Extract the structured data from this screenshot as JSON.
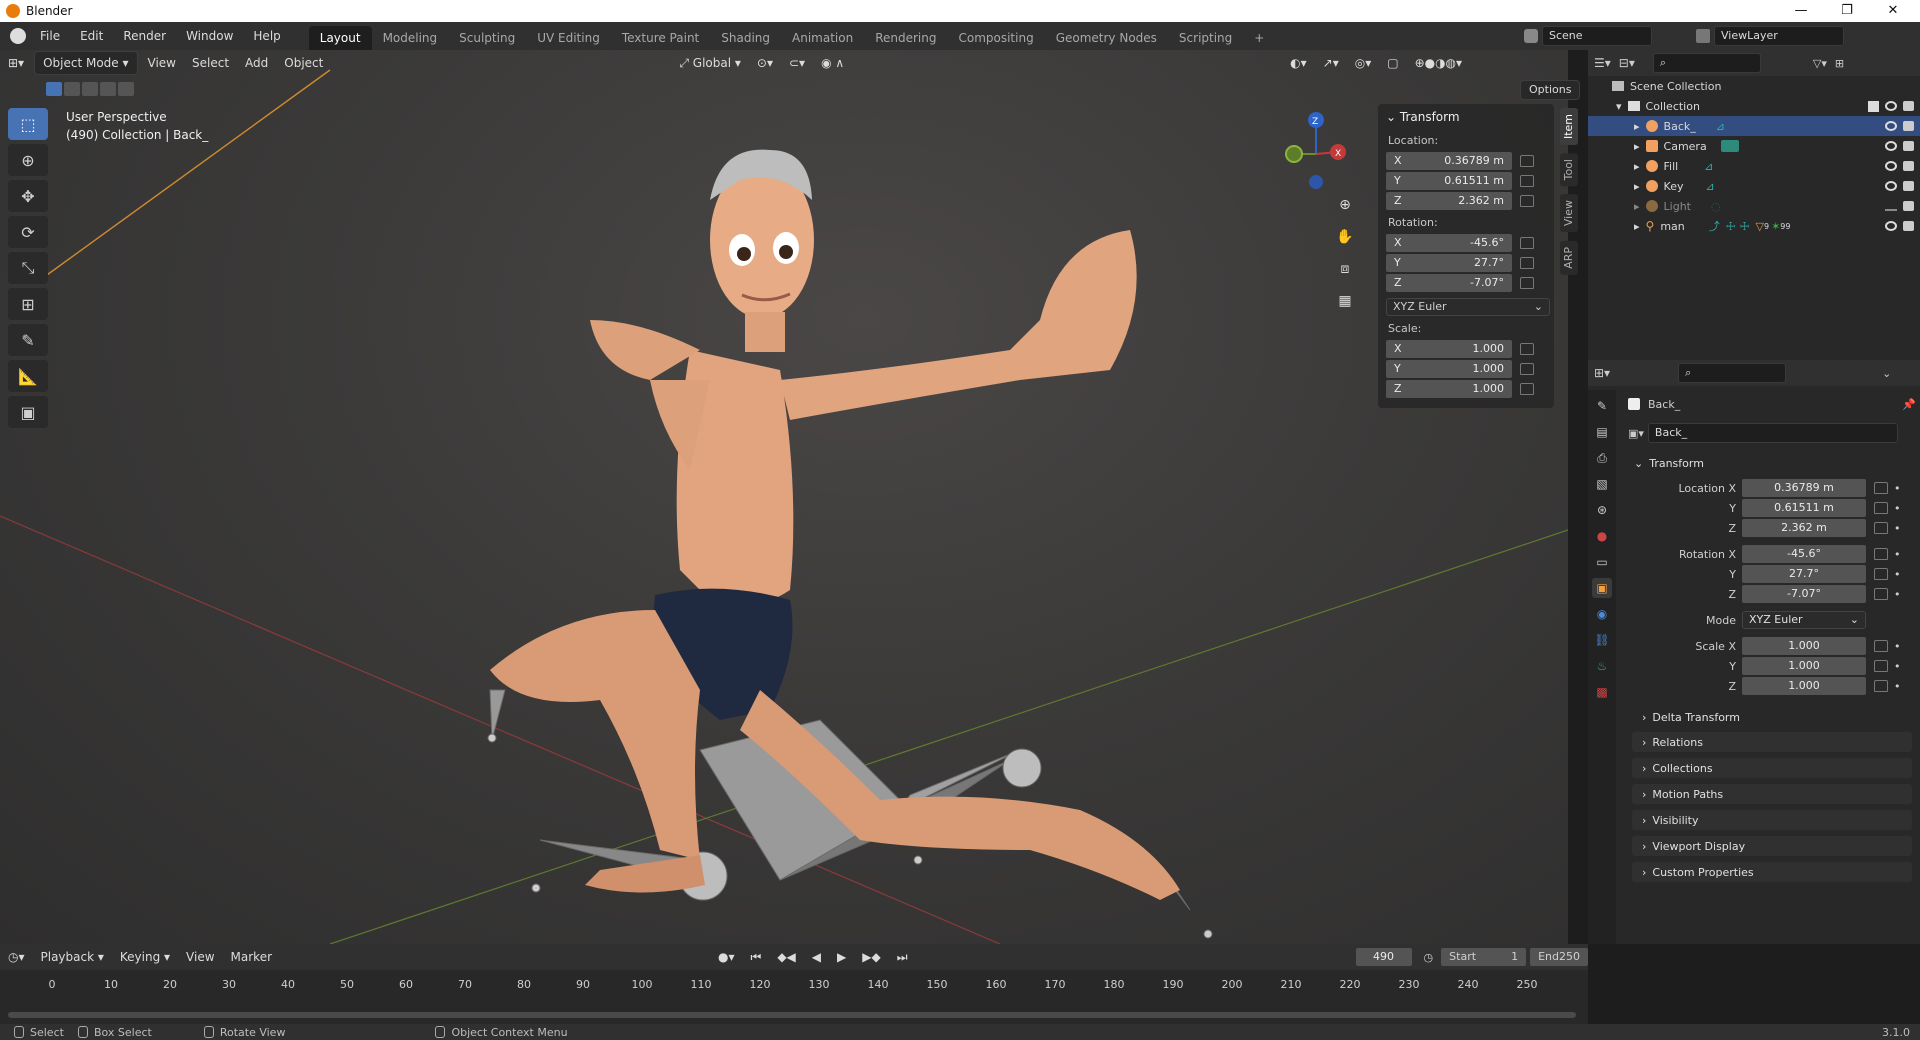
{
  "window": {
    "title": "Blender",
    "minimize": "—",
    "restore": "❐",
    "close": "✕"
  },
  "menu": [
    "File",
    "Edit",
    "Render",
    "Window",
    "Help"
  ],
  "workspaces": [
    "Layout",
    "Modeling",
    "Sculpting",
    "UV Editing",
    "Texture Paint",
    "Shading",
    "Animation",
    "Rendering",
    "Compositing",
    "Geometry Nodes",
    "Scripting",
    "+"
  ],
  "active_workspace": "Layout",
  "scene": {
    "name": "Scene",
    "view_layer": "ViewLayer"
  },
  "viewport_header": {
    "mode": "Object Mode",
    "menus": [
      "View",
      "Select",
      "Add",
      "Object"
    ],
    "orientation": "Global",
    "options": "Options"
  },
  "viewport": {
    "perspective": "User Perspective",
    "collection_info": "(490) Collection | Back_"
  },
  "n_panel": {
    "header": "Transform",
    "location_label": "Location:",
    "location": [
      {
        "axis": "X",
        "value": "0.36789 m"
      },
      {
        "axis": "Y",
        "value": "0.61511 m"
      },
      {
        "axis": "Z",
        "value": "2.362 m"
      }
    ],
    "rotation_label": "Rotation:",
    "rotation": [
      {
        "axis": "X",
        "value": "-45.6°"
      },
      {
        "axis": "Y",
        "value": "27.7°"
      },
      {
        "axis": "Z",
        "value": "-7.07°"
      }
    ],
    "rotation_mode": "XYZ Euler",
    "scale_label": "Scale:",
    "scale": [
      {
        "axis": "X",
        "value": "1.000"
      },
      {
        "axis": "Y",
        "value": "1.000"
      },
      {
        "axis": "Z",
        "value": "1.000"
      }
    ],
    "tabs": [
      "Item",
      "Tool",
      "View",
      "ARP"
    ]
  },
  "gizmo": {
    "z": "Z",
    "x": "X"
  },
  "outliner": {
    "scene_collection": "Scene Collection",
    "collection": "Collection",
    "items": [
      {
        "name": "Back_",
        "icon_color": "#f0a060",
        "selected": true
      },
      {
        "name": "Camera",
        "icon_color": "#f0a060",
        "selected": false
      },
      {
        "name": "Fill",
        "icon_color": "#f0a060",
        "selected": false
      },
      {
        "name": "Key",
        "icon_color": "#f0a060",
        "selected": false
      },
      {
        "name": "Light",
        "icon_color": "#8a6a40",
        "selected": false
      },
      {
        "name": "man",
        "icon_color": "#e8a050",
        "selected": false
      }
    ],
    "man_badges": {
      "b1": "9",
      "b2": "99"
    }
  },
  "properties": {
    "object_name": "Back_",
    "data_name": "Back_",
    "transform_header": "Transform",
    "location_x_label": "Location X",
    "y_label": "Y",
    "z_label": "Z",
    "location": [
      "0.36789 m",
      "0.61511 m",
      "2.362 m"
    ],
    "rotation_x_label": "Rotation X",
    "rotation": [
      "-45.6°",
      "27.7°",
      "-7.07°"
    ],
    "mode_label": "Mode",
    "mode_value": "XYZ Euler",
    "scale_x_label": "Scale X",
    "scale": [
      "1.000",
      "1.000",
      "1.000"
    ],
    "delta": "Delta Transform",
    "sections": [
      "Relations",
      "Collections",
      "Motion Paths",
      "Visibility",
      "Viewport Display",
      "Custom Properties"
    ]
  },
  "timeline": {
    "menus": [
      "Playback",
      "Keying",
      "View",
      "Marker"
    ],
    "current_frame": "490",
    "start_label": "Start",
    "start": "1",
    "end_label": "End",
    "end": "250",
    "ticks": [
      "0",
      "10",
      "20",
      "30",
      "40",
      "50",
      "60",
      "70",
      "80",
      "90",
      "100",
      "110",
      "120",
      "130",
      "140",
      "150",
      "160",
      "170",
      "180",
      "190",
      "200",
      "210",
      "220",
      "230",
      "240",
      "250"
    ]
  },
  "statusbar": {
    "select": "Select",
    "box_select": "Box Select",
    "rotate": "Rotate View",
    "context": "Object Context Menu",
    "version": "3.1.0"
  }
}
